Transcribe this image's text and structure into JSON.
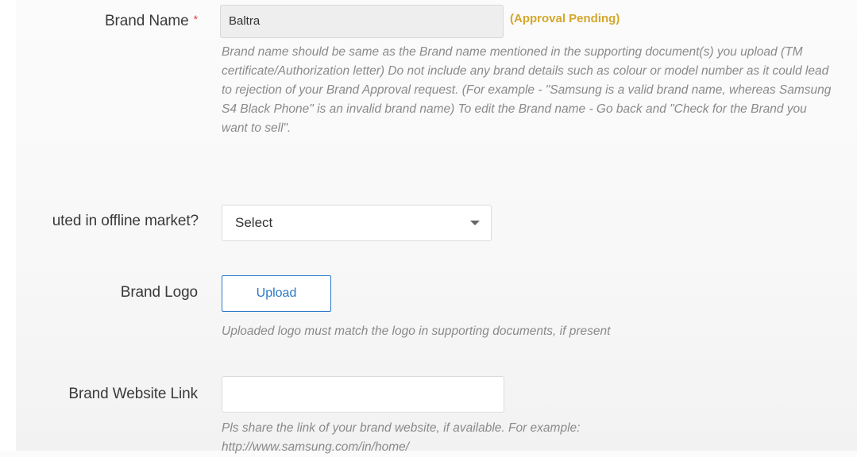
{
  "brand_name": {
    "label": "Brand Name",
    "required_mark": "*",
    "value": "Baltra",
    "status": "(Approval Pending)",
    "help": "Brand name should be same as the Brand name mentioned in the supporting document(s) you upload (TM certificate/Authorization letter) Do not include any brand details such as colour or model number as it could lead to rejection of your Brand Approval request. (For example - \"Samsung is a valid brand name, whereas Samsung S4 Black Phone\" is an invalid brand name) To edit the Brand name - Go back and \"Check for the Brand you want to sell\"."
  },
  "offline_market": {
    "label": "uted in offline market?",
    "selected": "Select"
  },
  "brand_logo": {
    "label": "Brand Logo",
    "button_label": "Upload",
    "help": "Uploaded logo must match the logo in supporting documents, if present"
  },
  "brand_website": {
    "label": "Brand Website Link",
    "value": "",
    "help": "Pls share the link of your brand website, if available. For example: http://www.samsung.com/in/home/"
  },
  "colors": {
    "status": "#d4a72c",
    "required": "#e0443a",
    "link_blue": "#2a77c8"
  }
}
